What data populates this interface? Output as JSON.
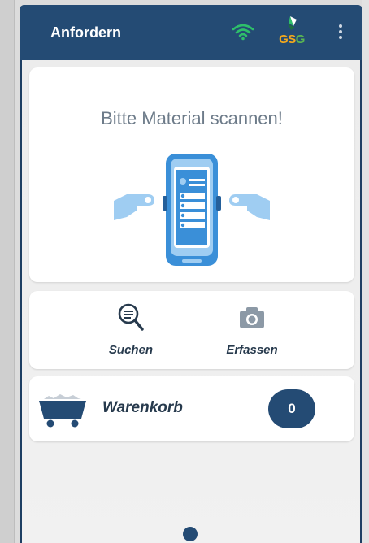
{
  "appbar": {
    "title": "Anfordern",
    "icons": [
      "wifi-icon",
      "gsg-logo",
      "more-vert-icon"
    ],
    "logo_text": [
      "G",
      "S",
      "G"
    ]
  },
  "scan": {
    "prompt": "Bitte Material scannen!",
    "illustration": "scanner-device-icon"
  },
  "actions": {
    "search_label": "Suchen",
    "search_icon": "search-document-icon",
    "capture_label": "Erfassen",
    "capture_icon": "camera-icon"
  },
  "cart": {
    "label": "Warenkorb",
    "icon": "cart-icon",
    "count": "0"
  },
  "colors": {
    "appbar": "#244b74",
    "accent": "#244b74",
    "illustration_blue": "#3a8fd8",
    "illustration_light": "#9fcdf2",
    "wifi_green": "#2ebf6a"
  }
}
